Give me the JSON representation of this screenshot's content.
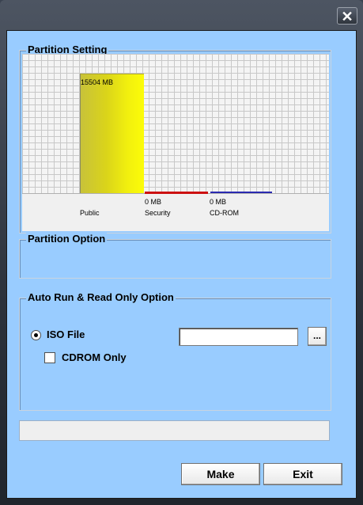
{
  "window": {
    "close_glyph": "✕"
  },
  "partition_setting": {
    "title": "Partition Setting",
    "chart_data": {
      "type": "bar",
      "categories": [
        "Public",
        "Security",
        "CD-ROM"
      ],
      "values": [
        15504,
        0,
        0
      ],
      "value_labels": [
        "15504 MB",
        "0 MB",
        "0 MB"
      ],
      "colors": [
        "#f2f00e",
        "#cc1111",
        "#2a2ab0"
      ],
      "grid": true
    }
  },
  "partition_option": {
    "title": "Partition Option"
  },
  "autorun": {
    "title": "Auto Run & Read Only Option",
    "iso_label": "ISO File",
    "iso_selected": true,
    "iso_path": "",
    "browse_label": "...",
    "cdrom_label": "CDROM Only",
    "cdrom_checked": false
  },
  "status": {
    "text": ""
  },
  "buttons": {
    "make": "Make",
    "exit": "Exit"
  }
}
